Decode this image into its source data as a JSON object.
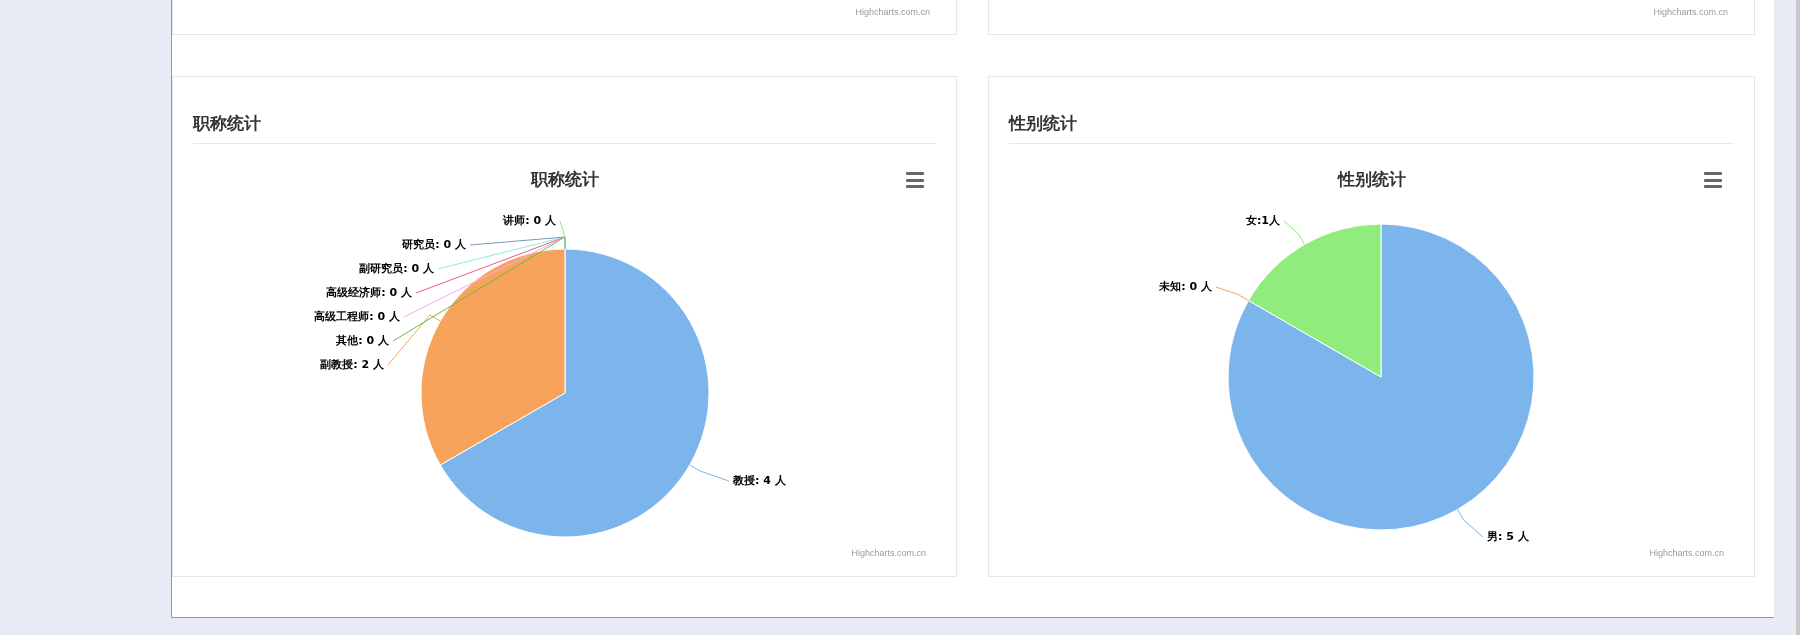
{
  "top_cards": [
    {
      "credits": "Highcharts.com.cn"
    },
    {
      "credits": "Highcharts.com.cn"
    }
  ],
  "cards": [
    {
      "heading": "职称统计",
      "chart": {
        "credits": "Highcharts.com.cn",
        "chart_data": {
          "type": "pie",
          "title": "职称统计",
          "categories": [
            "教授",
            "副教授",
            "其他",
            "高级工程师",
            "高级经济师",
            "副研究员",
            "研究员",
            "讲师"
          ],
          "values": [
            4,
            2,
            0,
            0,
            0,
            0,
            0,
            0
          ],
          "colors": [
            "#7cb5ec",
            "#f7a35c",
            "#66bb44",
            "#f0a8ec",
            "#f15c80",
            "#91e8e1",
            "#7798bf",
            "#90ed7d"
          ],
          "value_labels": [
            ": 4 人",
            ": 2 人",
            ": 0 人",
            ": 0 人",
            ": 0 人",
            ": 0 人",
            ": 0 人",
            ": 0 人"
          ]
        }
      }
    },
    {
      "heading": "性别统计",
      "chart": {
        "credits": "Highcharts.com.cn",
        "chart_data": {
          "type": "pie",
          "title": "性别统计",
          "categories": [
            "男",
            "未知",
            "女"
          ],
          "values": [
            5,
            0,
            1
          ],
          "colors": [
            "#7cb5ec",
            "#f7a35c",
            "#90ed7d"
          ],
          "value_labels": [
            ": 5 人",
            ": 0 人",
            ":1人"
          ]
        }
      }
    }
  ]
}
